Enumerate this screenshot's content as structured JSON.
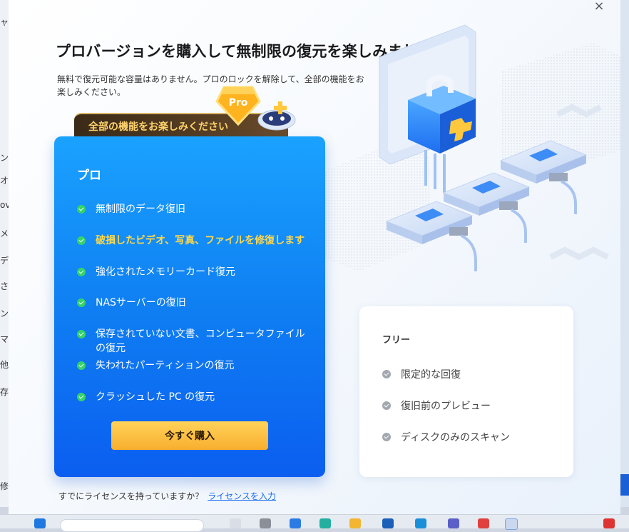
{
  "dialog": {
    "close_label": "×",
    "title": "プロバージョンを購入して無制限の復元を楽しみましょう",
    "subtitle": "無料で復元可能な容量はありません。プロのロックを解除して、全部の機能をお楽しみください。",
    "ribbon_text": "全部の機能をお楽しみください",
    "badge_text": "Pro"
  },
  "pro_plan": {
    "title": "プロ",
    "features": [
      {
        "label": "無制限のデータ復旧",
        "highlight": false
      },
      {
        "label": "破損したビデオ、写真、ファイルを修復します",
        "highlight": true
      },
      {
        "label": "強化されたメモリーカード復元",
        "highlight": false
      },
      {
        "label": "NASサーバーの復旧",
        "highlight": false
      },
      {
        "label": "保存されていない文書、コンピュータファイルの復元",
        "highlight": false
      },
      {
        "label": "失われたパーティションの復元",
        "highlight": false
      },
      {
        "label": "クラッシュした PC の復元",
        "highlight": false
      }
    ],
    "buy_label": "今すぐ購入"
  },
  "free_plan": {
    "title": "フリー",
    "features": [
      {
        "label": "限定的な回復"
      },
      {
        "label": "復旧前のプレビュー"
      },
      {
        "label": "ディスクのみのスキャン"
      }
    ]
  },
  "footer": {
    "question": "すでにライセンスを持っていますか？",
    "link": "ライセンスを入力"
  },
  "colors": {
    "accent": "#0f7ff2",
    "buy_button": "#f8ae2e",
    "highlight_text": "#ffd84a",
    "check_green": "#35d36a",
    "link": "#1a6cf0"
  },
  "background_app": {
    "fragments": [
      "ャ",
      "ン",
      "オ",
      "ov",
      "メ",
      "デ",
      "さ",
      "ン",
      "マ",
      "他",
      "存",
      "修"
    ]
  }
}
